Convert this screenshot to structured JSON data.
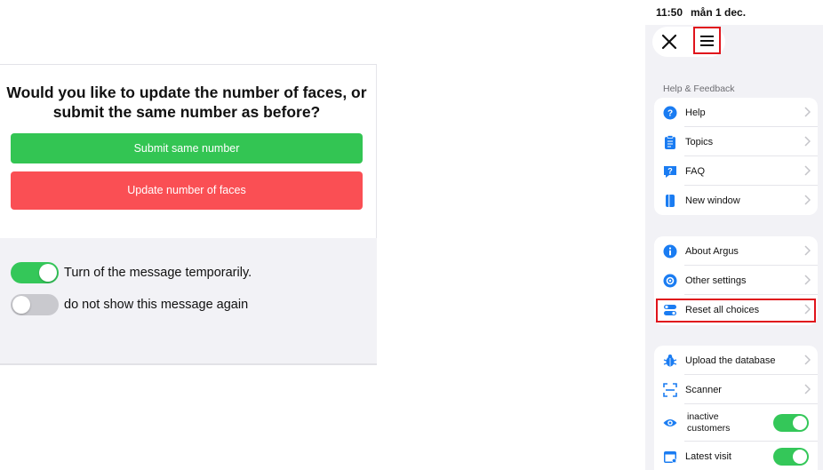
{
  "dialog": {
    "title": "Would you like to update the number of faces, or submit the same number as before?",
    "submit_same_label": "Submit same number",
    "update_label": "Update number of faces",
    "options": [
      {
        "label": "Turn of the message temporarily.",
        "enabled": true
      },
      {
        "label": "do not show this message again",
        "enabled": false
      }
    ]
  },
  "phone": {
    "status_time": "11:50",
    "status_date": "mån 1 dec.",
    "section_header": "Help & Feedback",
    "group1": [
      {
        "label": "Help",
        "icon": "question-icon"
      },
      {
        "label": "Topics",
        "icon": "clipboard-icon"
      },
      {
        "label": "FAQ",
        "icon": "chat-question-icon"
      },
      {
        "label": "New window",
        "icon": "bookmark-icon"
      }
    ],
    "group2": [
      {
        "label": "About Argus",
        "icon": "info-icon"
      },
      {
        "label": "Other settings",
        "icon": "settings-circle-icon"
      },
      {
        "label": "Reset all choices",
        "icon": "toggles-icon"
      }
    ],
    "group3": [
      {
        "label": "Upload the database",
        "icon": "bug-icon"
      },
      {
        "label": "Scanner",
        "icon": "scan-icon"
      },
      {
        "label": "inactive customers",
        "icon": "eye-icon",
        "toggle": true
      },
      {
        "label": "Latest visit",
        "icon": "calendar-icon",
        "toggle": true
      }
    ]
  },
  "colors": {
    "green": "#33c553",
    "red": "#fa4f54",
    "blue": "#1a7cf2",
    "highlight": "#e0141c"
  }
}
